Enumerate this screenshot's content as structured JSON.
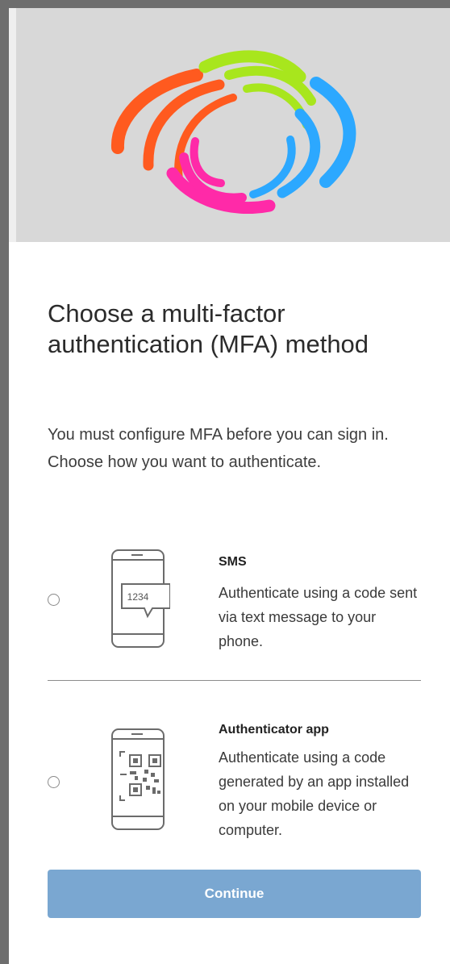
{
  "header": {
    "logo_icon": "swirl-logo-icon",
    "logo_colors": [
      "#ff5a1f",
      "#a8e61d",
      "#2ca8ff",
      "#ff2aa8"
    ]
  },
  "main": {
    "title": "Choose a multi-factor authentication (MFA) method",
    "subtitle": "You must configure MFA before you can sign in. Choose how you want to authenticate."
  },
  "options": [
    {
      "id": "sms",
      "title": "SMS",
      "description": "Authenticate using a code sent via text message to your phone.",
      "icon": "phone-sms-icon",
      "code": "1234",
      "selected": false
    },
    {
      "id": "authenticator",
      "title": "Authenticator app",
      "description": "Authenticate using a code generated by an app installed on your mobile device or computer.",
      "icon": "phone-qr-icon",
      "selected": false
    }
  ],
  "actions": {
    "continue_label": "Continue",
    "continue_color": "#7aa7d1"
  }
}
